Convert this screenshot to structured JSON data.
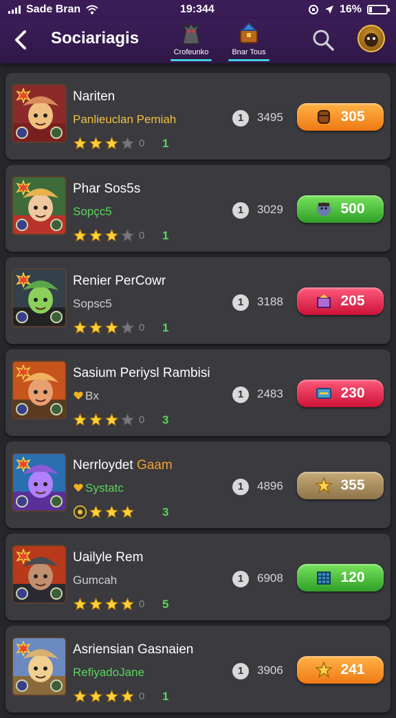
{
  "status": {
    "carrier": "Sade Bran",
    "time": "19:344",
    "battery": "16%",
    "battery_level": 0.16
  },
  "header": {
    "title": "Sociariagis",
    "tabs": [
      {
        "label": "Crofeunko",
        "icon": "dragon-icon"
      },
      {
        "label": "Bnar Tous",
        "icon": "treasure-chest-icon"
      }
    ]
  },
  "colors": {
    "statusbar": "#3a1c57",
    "navbar": "#3b1d58",
    "background": "#26262b",
    "card": "#3a3a3f",
    "tab_underline": "#3fd0e0",
    "sub_gold": "#f0c040",
    "sub_green": "#5cd65c",
    "sub_gray": "#d0d0d0"
  },
  "players": [
    {
      "name": "Nariten",
      "name_accent": "",
      "sub": "Panlieuclan Pemiah",
      "sub_color": "#f0c040",
      "sub_icon": "",
      "stars": 3,
      "max_stars": 4,
      "star_score": "0",
      "count": "1",
      "rank": "1",
      "points": "3495",
      "button": {
        "value": "305",
        "color": "orange",
        "icon": "barrel-icon"
      },
      "portrait": "red-hat-hero"
    },
    {
      "name": "Phar Sos5s",
      "name_accent": "",
      "sub": "Sopçc5",
      "sub_color": "#5cd65c",
      "sub_icon": "",
      "stars": 3,
      "max_stars": 4,
      "star_score": "0",
      "count": "1",
      "rank": "1",
      "points": "3029",
      "button": {
        "value": "500",
        "color": "green",
        "icon": "face-icon"
      },
      "portrait": "blond-warrior"
    },
    {
      "name": "Renier PerCowr",
      "name_accent": "",
      "sub": "Sopsc5",
      "sub_color": "#d0d0d0",
      "sub_icon": "",
      "stars": 3,
      "max_stars": 4,
      "star_score": "0",
      "count": "1",
      "rank": "1",
      "points": "3188",
      "button": {
        "value": "205",
        "color": "red",
        "icon": "gem-box-icon"
      },
      "portrait": "green-witch"
    },
    {
      "name": "Sasium Periysl Rambisi",
      "name_accent": "",
      "sub": "Bx",
      "sub_color": "#d0d0d0",
      "sub_icon": "heart-icon",
      "stars": 3,
      "max_stars": 4,
      "star_score": "0",
      "count": "3",
      "rank": "1",
      "points": "2483",
      "button": {
        "value": "230",
        "color": "red",
        "icon": "ticket-icon"
      },
      "portrait": "cowboy-gunner"
    },
    {
      "name": "Nerrloydet",
      "name_accent": "Gaam",
      "sub": "Systatc",
      "sub_color": "#5cd65c",
      "sub_icon": "heart-icon",
      "stars": 3,
      "max_stars": 3,
      "star_score": "",
      "count": "3",
      "rank": "1",
      "points": "4896",
      "button": {
        "value": "355",
        "color": "tan",
        "icon": "star-burst-icon"
      },
      "portrait": "purple-monster",
      "lead_icon": "coin-icon"
    },
    {
      "name": "Uailyle Rem",
      "name_accent": "",
      "sub": "Gumcah",
      "sub_color": "#d0d0d0",
      "sub_icon": "",
      "stars": 4,
      "max_stars": 4,
      "star_score": "0",
      "count": "5",
      "rank": "1",
      "points": "6908",
      "button": {
        "value": "120",
        "color": "green",
        "icon": "crate-icon"
      },
      "portrait": "heavy-gunner"
    },
    {
      "name": "Asriensian Gasnaien",
      "name_accent": "",
      "sub": "RefiyadoJane",
      "sub_color": "#5cd65c",
      "sub_icon": "",
      "stars": 4,
      "max_stars": 4,
      "star_score": "0",
      "count": "1",
      "rank": "1",
      "points": "3906",
      "button": {
        "value": "241",
        "color": "orange",
        "icon": "star-burst-icon"
      },
      "portrait": "temple"
    }
  ]
}
